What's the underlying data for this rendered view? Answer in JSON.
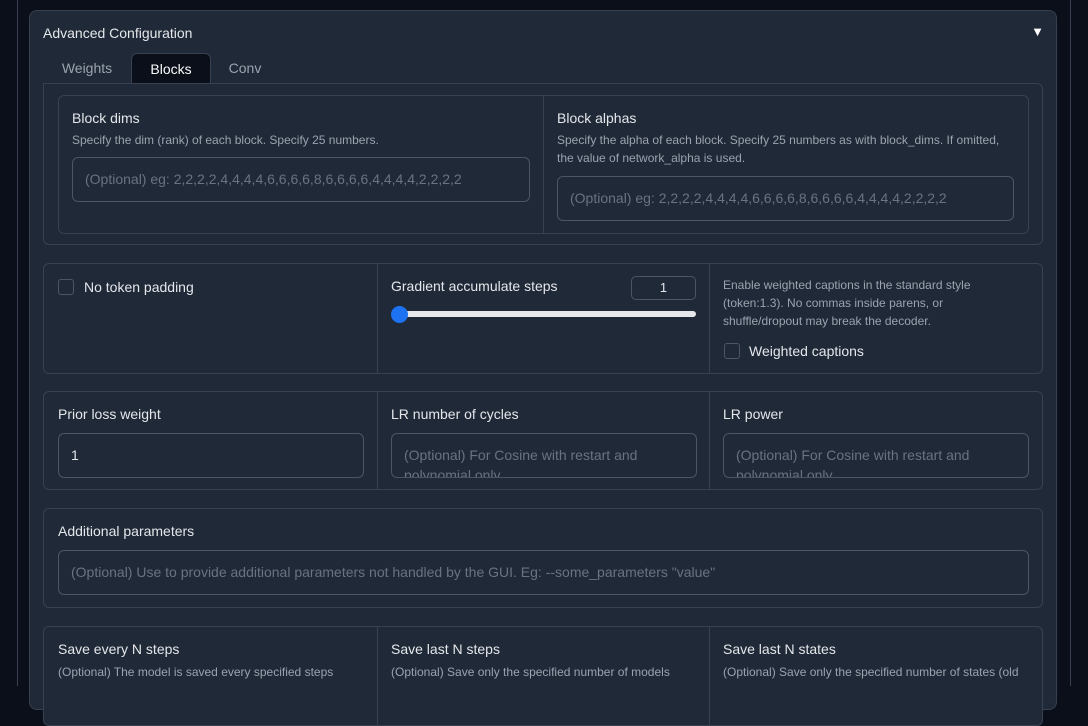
{
  "accordion": {
    "title": "Advanced Configuration",
    "toggle_icon": "▼"
  },
  "tabs": [
    {
      "label": "Weights"
    },
    {
      "label": "Blocks"
    },
    {
      "label": "Conv"
    }
  ],
  "blocks": {
    "dims": {
      "label": "Block dims",
      "info": "Specify the dim (rank) of each block. Specify 25 numbers.",
      "placeholder": "(Optional) eg: 2,2,2,2,4,4,4,4,6,6,6,6,8,6,6,6,6,4,4,4,4,2,2,2,2"
    },
    "alphas": {
      "label": "Block alphas",
      "info": "Specify the alpha of each block. Specify 25 numbers as with block_dims. If omitted, the value of network_alpha is used.",
      "placeholder": "(Optional) eg: 2,2,2,2,4,4,4,4,6,6,6,6,8,6,6,6,6,4,4,4,4,2,2,2,2"
    }
  },
  "row2": {
    "no_token_padding": {
      "label": "No token padding",
      "checked": false
    },
    "grad_accum": {
      "label": "Gradient accumulate steps",
      "value": "1",
      "slider_fraction": 0.0
    },
    "weighted": {
      "info": "Enable weighted captions in the standard style (token:1.3). No commas inside parens, or shuffle/dropout may break the decoder.",
      "label": "Weighted captions",
      "checked": false
    }
  },
  "row3": {
    "prior_loss": {
      "label": "Prior loss weight",
      "value": "1"
    },
    "lr_cycles": {
      "label": "LR number of cycles",
      "placeholder": "(Optional) For Cosine with restart and polynomial only"
    },
    "lr_power": {
      "label": "LR power",
      "placeholder": "(Optional) For Cosine with restart and polynomial only"
    }
  },
  "additional": {
    "label": "Additional parameters",
    "placeholder": "(Optional) Use to provide additional parameters not handled by the GUI. Eg: --some_parameters \"value\""
  },
  "row5": {
    "save_every": {
      "label": "Save every N steps",
      "info": "(Optional) The model is saved every specified steps"
    },
    "save_last": {
      "label": "Save last N steps",
      "info": "(Optional) Save only the specified number of models"
    },
    "save_states": {
      "label": "Save last N states",
      "info": "(Optional) Save only the specified number of states (old"
    }
  }
}
